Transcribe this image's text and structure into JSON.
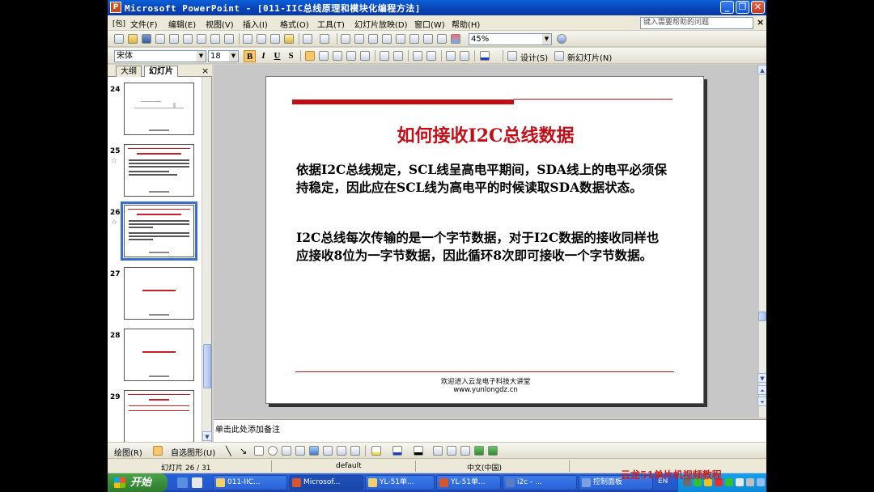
{
  "window": {
    "title": "Microsoft PowerPoint - [011-IIC总线原理和模块化编程方法]",
    "app_icon": "powerpoint-icon",
    "buttons": [
      "minimize",
      "restore",
      "close"
    ]
  },
  "menu": {
    "items": [
      "文件(F)",
      "编辑(E)",
      "视图(V)",
      "插入(I)",
      "格式(O)",
      "工具(T)",
      "幻灯片放映(D)",
      "窗口(W)",
      "帮助(H)"
    ],
    "help_placeholder": "键入需要帮助的问题"
  },
  "toolbar": {
    "zoom": "45%",
    "font": "宋体",
    "font_size": "18",
    "bold_label": "B",
    "italic_label": "I",
    "underline_label": "U",
    "shadow_label": "S",
    "design_label": "设计(S)",
    "new_slide_label": "新幻灯片(N)"
  },
  "panel": {
    "tab_outline": "大纲",
    "tab_slides": "幻灯片",
    "thumbnails": [
      {
        "num": "24",
        "selected": false
      },
      {
        "num": "25",
        "selected": false
      },
      {
        "num": "26",
        "selected": true
      },
      {
        "num": "27",
        "selected": false
      },
      {
        "num": "28",
        "selected": false
      },
      {
        "num": "29",
        "selected": false
      }
    ]
  },
  "slide": {
    "title": "如何接收I2C总线数据",
    "paragraph1": "依据I2C总线规定，SCL线呈高电平期间，SDA线上的电平必须保持稳定，因此应在SCL线为高电平的时候读取SDA数据状态。",
    "paragraph2": "I2C总线每次传输的是一个字节数据，对于I2C数据的接收同样也应接收8位为一字节数据，因此循环8次即可接收一个字节数据。",
    "footer_line1": "欢迎进入云龙电子科技大讲堂",
    "footer_line2": "www.yunlongdz.cn",
    "accent_color": "#c40e14"
  },
  "notes": {
    "placeholder": "单击此处添加备注"
  },
  "drawing": {
    "draw_label": "绘图(R)",
    "autoshapes_label": "自选图形(U)"
  },
  "status": {
    "slide_info": "幻灯片 26 / 31",
    "design": "default",
    "language": "中文(中国)"
  },
  "taskbar": {
    "start": "开始",
    "tasks": [
      "011-IIC...",
      "Microsof...",
      "YL-51单...",
      "YL-51单...",
      "i2c  -  ...",
      "控制面板"
    ],
    "lang_indicator": "EN"
  },
  "watermark": "云龙51单片机视频教程"
}
